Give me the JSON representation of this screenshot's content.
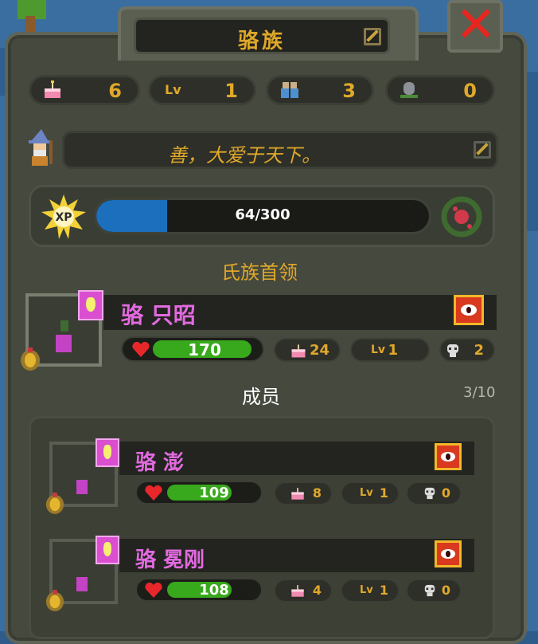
{
  "clan": {
    "title": "骆族",
    "motto": "善，大爱于天下。"
  },
  "stats": {
    "cake": "6",
    "lv_label": "Lv",
    "level": "1",
    "members": "3",
    "graves": "0"
  },
  "xp": {
    "badge": "XP",
    "text": "64/300",
    "fraction": 0.213
  },
  "leader_section": "氏族首领",
  "leader": {
    "name": "骆 只昭",
    "hp": "170",
    "hp_fraction": 1.0,
    "cake": "24",
    "lv_label": "Lv",
    "level": "1",
    "skulls": "2"
  },
  "members_section": {
    "label": "成员",
    "count": "3/10"
  },
  "members": [
    {
      "name": "骆 澎",
      "hp": "109",
      "hp_fraction": 0.7,
      "cake": "8",
      "lv_label": "Lv",
      "level": "1",
      "skulls": "0"
    },
    {
      "name": "骆 冕刚",
      "hp": "108",
      "hp_fraction": 0.7,
      "cake": "4",
      "lv_label": "Lv",
      "level": "1",
      "skulls": "0"
    }
  ],
  "colors": {
    "accent": "#e0a82a",
    "name": "#e26ae0",
    "hp": "#38a81c",
    "xp": "#1b6fbd",
    "close": "#e8261f"
  },
  "icons": [
    "cake-icon",
    "level-icon",
    "members-icon",
    "grave-icon",
    "wizard-icon",
    "edit-icon",
    "sun-xp-icon",
    "rose-wreath-icon",
    "foot-icon",
    "eye-icon",
    "heart-icon",
    "skull-icon",
    "beetle-icon",
    "close-icon"
  ]
}
